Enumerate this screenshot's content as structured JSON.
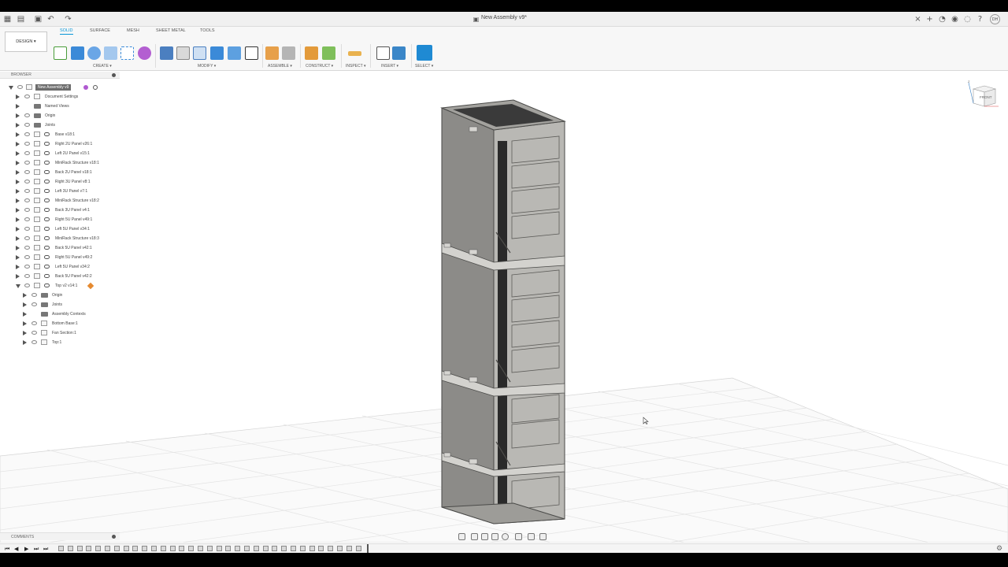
{
  "title_bar": {
    "document_title": "New Assembly v9*"
  },
  "workspace": {
    "mode_label": "DESIGN ▾"
  },
  "ribbon": {
    "tabs": [
      "SOLID",
      "SURFACE",
      "MESH",
      "SHEET METAL",
      "TOOLS"
    ],
    "active_tab": "SOLID",
    "groups": [
      "CREATE ▾",
      "MODIFY ▾",
      "ASSEMBLE ▾",
      "CONSTRUCT ▾",
      "INSPECT ▾",
      "INSERT ▾",
      "SELECT ▾"
    ]
  },
  "browser": {
    "title": "BROWSER",
    "root": "New Assembly v9",
    "items": [
      {
        "label": "Document Settings",
        "kind": "gear"
      },
      {
        "label": "Named Views",
        "kind": "folder"
      },
      {
        "label": "Origin",
        "kind": "folder"
      },
      {
        "label": "Joints",
        "kind": "folder"
      },
      {
        "label": "Base v18:1",
        "kind": "component"
      },
      {
        "label": "Right 2U Panel v26:1",
        "kind": "component"
      },
      {
        "label": "Left 2U Panel v15:1",
        "kind": "component"
      },
      {
        "label": "MiniRack Structure v18:1",
        "kind": "component"
      },
      {
        "label": "Back 2U Panel v18:1",
        "kind": "component"
      },
      {
        "label": "Right 3U Panel v8:1",
        "kind": "component"
      },
      {
        "label": "Left 3U Panel v7:1",
        "kind": "component"
      },
      {
        "label": "MiniRack Structure v18:2",
        "kind": "component"
      },
      {
        "label": "Back 3U Panel v4:1",
        "kind": "component"
      },
      {
        "label": "Right 5U Panel v49:1",
        "kind": "component"
      },
      {
        "label": "Left 5U Panel v34:1",
        "kind": "component"
      },
      {
        "label": "MiniRack Structure v18:3",
        "kind": "component"
      },
      {
        "label": "Back 5U Panel v42:1",
        "kind": "component"
      },
      {
        "label": "Right 5U Panel v49:2",
        "kind": "component"
      },
      {
        "label": "Left 5U Panel v34:2",
        "kind": "component"
      },
      {
        "label": "Back 5U Panel v42:2",
        "kind": "component"
      },
      {
        "label": "Top v2 v14:1",
        "kind": "component-open"
      }
    ],
    "children": [
      {
        "label": "Origin",
        "kind": "folder"
      },
      {
        "label": "Joints",
        "kind": "folder"
      },
      {
        "label": "Assembly Contexts",
        "kind": "folder"
      },
      {
        "label": "Bottom Base:1",
        "kind": "body"
      },
      {
        "label": "Fan Section:1",
        "kind": "body"
      },
      {
        "label": "Top:1",
        "kind": "body"
      }
    ]
  },
  "comments": {
    "title": "COMMENTS"
  },
  "viewcube": {
    "face_label": "FRONT",
    "axis_label": "Z"
  },
  "colors": {
    "accent": "#0696d7",
    "model_gray": "#8f8f8c",
    "grid": "#e3e3e3"
  },
  "timeline": {
    "controls": [
      "⏮",
      "◀",
      "▶",
      "⏭",
      "⏭"
    ]
  }
}
